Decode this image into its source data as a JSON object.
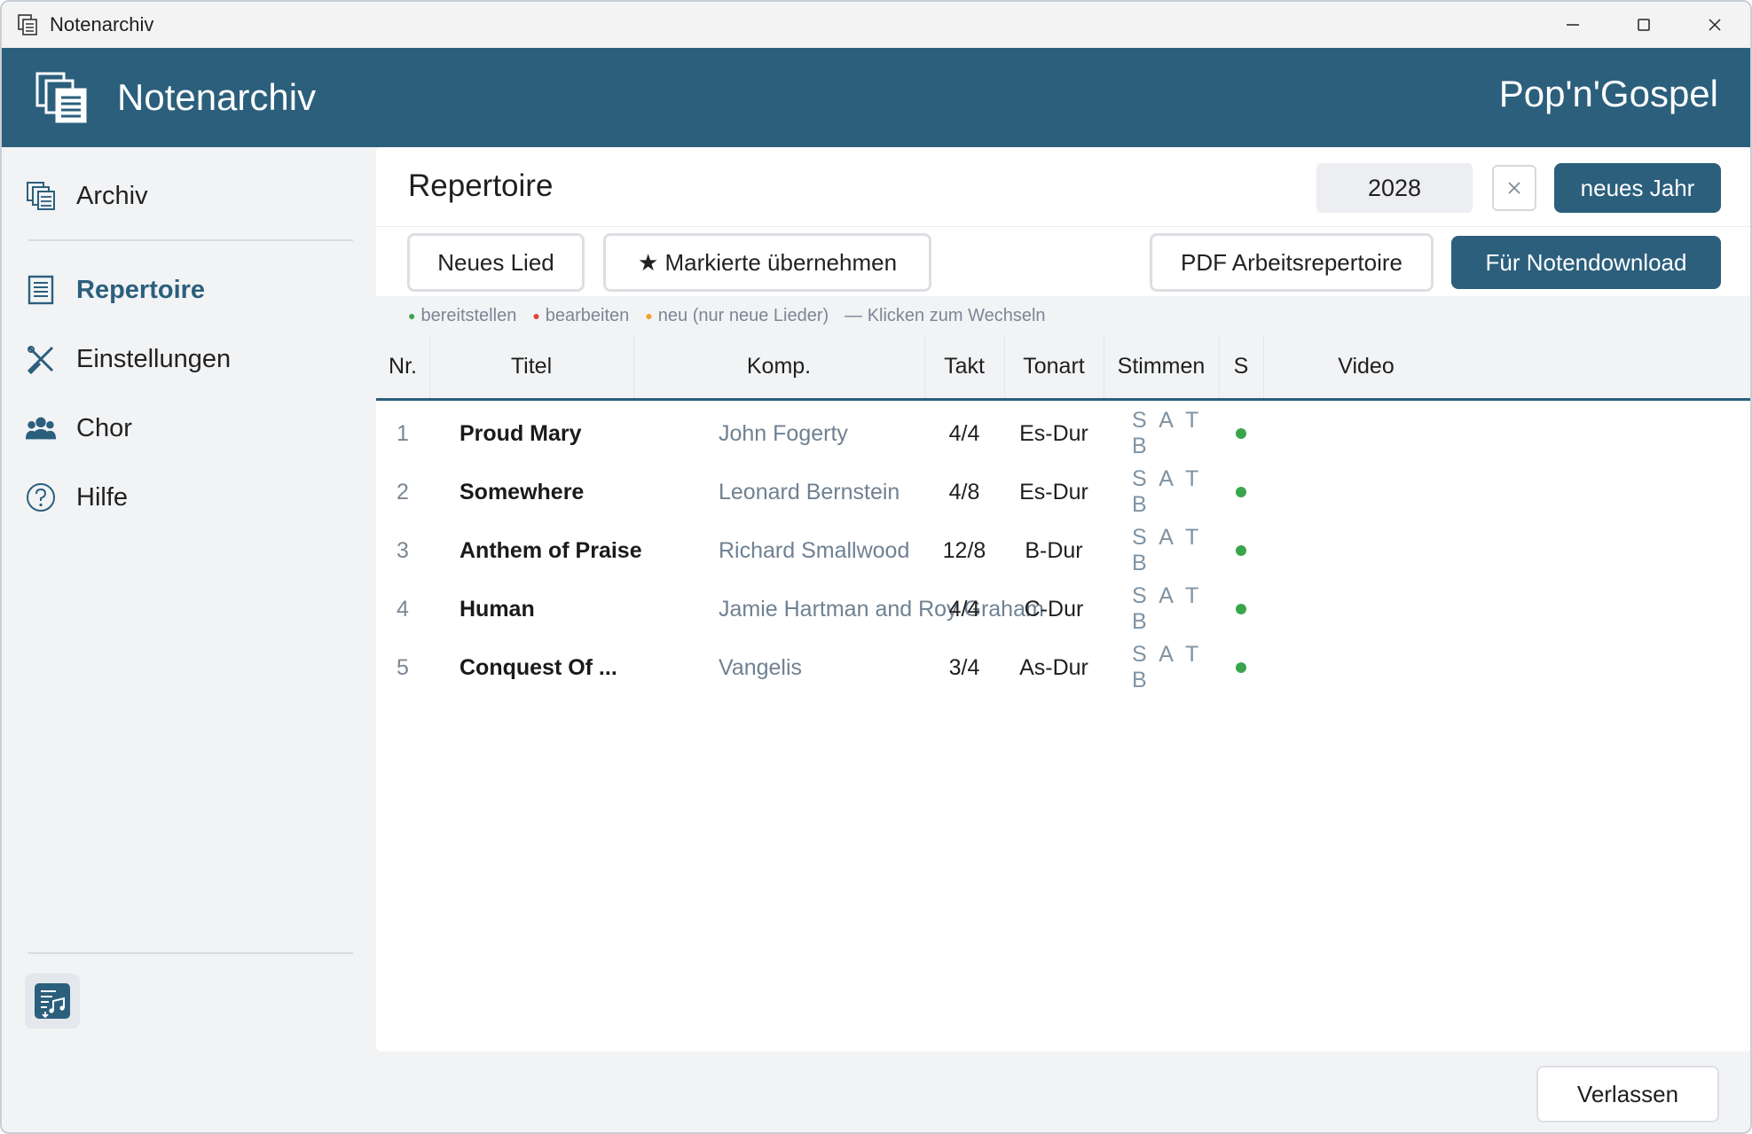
{
  "window": {
    "title": "Notenarchiv"
  },
  "header": {
    "brand": "Notenarchiv",
    "choir": "Pop'n'Gospel"
  },
  "sidebar": {
    "items": [
      {
        "label": "Archiv",
        "icon": "archive-icon",
        "active": false
      },
      {
        "label": "Repertoire",
        "icon": "document-list-icon",
        "active": true
      },
      {
        "label": "Einstellungen",
        "icon": "tools-icon",
        "active": false
      },
      {
        "label": "Chor",
        "icon": "group-icon",
        "active": false
      },
      {
        "label": "Hilfe",
        "icon": "help-icon",
        "active": false
      }
    ],
    "bottom_icon": "sheet-music-icon"
  },
  "main": {
    "title": "Repertoire",
    "year": "2028",
    "new_year_label": "neues Jahr",
    "new_song_label": "Neues Lied",
    "take_marked_label": "★ Markierte übernehmen",
    "pdf_label": "PDF Arbeitsrepertoire",
    "download_label": "Für Notendownload",
    "legend": {
      "provide": "bereitstellen",
      "edit": "bearbeiten",
      "new": "neu (nur neue Lieder)",
      "hint": "—  Klicken zum Wechseln"
    },
    "columns": [
      "Nr.",
      "Titel",
      "Komp.",
      "Takt",
      "Tonart",
      "Stimmen",
      "S",
      "Video"
    ],
    "rows": [
      {
        "nr": "1",
        "title": "Proud Mary",
        "composer": "John Fogerty",
        "takt": "4/4",
        "key": "Es-Dur",
        "voices": "S A T B",
        "status": "bereitstellen"
      },
      {
        "nr": "2",
        "title": "Somewhere",
        "composer": "Leonard Bernstein",
        "takt": "4/8",
        "key": "Es-Dur",
        "voices": "S A T B",
        "status": "bereitstellen"
      },
      {
        "nr": "3",
        "title": "Anthem of Praise",
        "composer": "Richard Smallwood",
        "takt": "12/8",
        "key": "B-Dur",
        "voices": "S A T B",
        "status": "bereitstellen"
      },
      {
        "nr": "4",
        "title": "Human",
        "composer": "Jamie Hartman and Roy Graham",
        "takt": "4/4",
        "key": "C-Dur",
        "voices": "S A T B",
        "status": "bereitstellen"
      },
      {
        "nr": "5",
        "title": "Conquest Of ...",
        "composer": "Vangelis",
        "takt": "3/4",
        "key": "As-Dur",
        "voices": "S A T B",
        "status": "bereitstellen"
      }
    ]
  },
  "footer": {
    "leave_label": "Verlassen"
  },
  "colors": {
    "accent": "#2b5f7c",
    "status_green": "#3aa64b",
    "status_red": "#e0433a",
    "status_orange": "#f0a020"
  }
}
